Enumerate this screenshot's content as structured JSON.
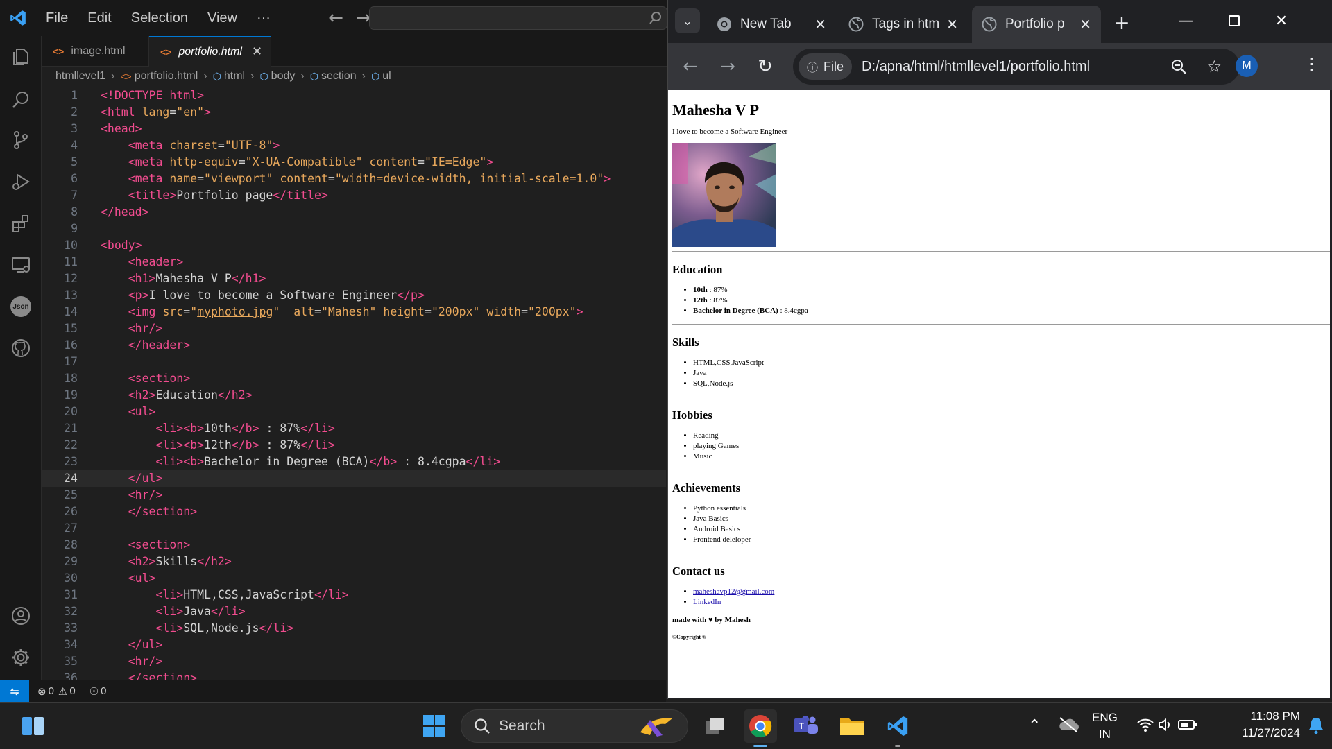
{
  "vscode": {
    "menu": [
      "File",
      "Edit",
      "Selection",
      "View",
      "···"
    ],
    "tabs": [
      {
        "label": "image.html",
        "active": false
      },
      {
        "label": "portfolio.html",
        "active": true
      }
    ],
    "breadcrumb": [
      "htmllevel1",
      "portfolio.html",
      "html",
      "body",
      "section",
      "ul"
    ],
    "current_line": 24,
    "status": {
      "errors": "0",
      "warnings": "0",
      "ports": "0"
    },
    "code_lines": [
      {
        "n": "1",
        "html": "<span class=\"t\">&lt;!DOCTYPE</span> <span class=\"t\">html</span><span class=\"t\">&gt;</span>"
      },
      {
        "n": "2",
        "html": "<span class=\"t\">&lt;html</span> <span class=\"a\">lang</span>=<span class=\"s\">\"en\"</span><span class=\"t\">&gt;</span>"
      },
      {
        "n": "3",
        "html": "<span class=\"t\">&lt;head&gt;</span>"
      },
      {
        "n": "4",
        "html": "    <span class=\"t\">&lt;meta</span> <span class=\"a\">charset</span>=<span class=\"s\">\"UTF-8\"</span><span class=\"t\">&gt;</span>"
      },
      {
        "n": "5",
        "html": "    <span class=\"t\">&lt;meta</span> <span class=\"a\">http-equiv</span>=<span class=\"s\">\"X-UA-Compatible\"</span> <span class=\"a\">content</span>=<span class=\"s\">\"IE=Edge\"</span><span class=\"t\">&gt;</span>"
      },
      {
        "n": "6",
        "html": "    <span class=\"t\">&lt;meta</span> <span class=\"a\">name</span>=<span class=\"s\">\"viewport\"</span> <span class=\"a\">content</span>=<span class=\"s\">\"width=device-width, initial-scale=1.0\"</span><span class=\"t\">&gt;</span>"
      },
      {
        "n": "7",
        "html": "    <span class=\"t\">&lt;title&gt;</span>Portfolio page<span class=\"t\">&lt;/title&gt;</span>"
      },
      {
        "n": "8",
        "html": "<span class=\"t\">&lt;/head&gt;</span>"
      },
      {
        "n": "9",
        "html": ""
      },
      {
        "n": "10",
        "html": "<span class=\"t\">&lt;body&gt;</span>"
      },
      {
        "n": "11",
        "html": "    <span class=\"t\">&lt;header&gt;</span>"
      },
      {
        "n": "12",
        "html": "    <span class=\"t\">&lt;h1&gt;</span>Mahesha V P<span class=\"t\">&lt;/h1&gt;</span>"
      },
      {
        "n": "13",
        "html": "    <span class=\"t\">&lt;p&gt;</span>I love to become a Software Engineer<span class=\"t\">&lt;/p&gt;</span>"
      },
      {
        "n": "14",
        "html": "    <span class=\"t\">&lt;img</span> <span class=\"a\">src</span>=<span class=\"s\">\"</span><span class=\"u\">myphoto.jpg</span><span class=\"s\">\"</span>  <span class=\"a\">alt</span>=<span class=\"s\">\"Mahesh\"</span> <span class=\"a\">height</span>=<span class=\"s\">\"200px\"</span> <span class=\"a\">width</span>=<span class=\"s\">\"200px\"</span><span class=\"t\">&gt;</span>"
      },
      {
        "n": "15",
        "html": "    <span class=\"t\">&lt;hr/&gt;</span>"
      },
      {
        "n": "16",
        "html": "    <span class=\"t\">&lt;/header&gt;</span>"
      },
      {
        "n": "17",
        "html": ""
      },
      {
        "n": "18",
        "html": "    <span class=\"t\">&lt;section&gt;</span>"
      },
      {
        "n": "19",
        "html": "    <span class=\"t\">&lt;h2&gt;</span>Education<span class=\"t\">&lt;/h2&gt;</span>"
      },
      {
        "n": "20",
        "html": "    <span class=\"t\">&lt;ul&gt;</span>"
      },
      {
        "n": "21",
        "html": "        <span class=\"t\">&lt;li&gt;&lt;b&gt;</span>10th<span class=\"t\">&lt;/b&gt;</span> : 87%<span class=\"t\">&lt;/li&gt;</span>"
      },
      {
        "n": "22",
        "html": "        <span class=\"t\">&lt;li&gt;&lt;b&gt;</span>12th<span class=\"t\">&lt;/b&gt;</span> : 87%<span class=\"t\">&lt;/li&gt;</span>"
      },
      {
        "n": "23",
        "html": "        <span class=\"t\">&lt;li&gt;&lt;b&gt;</span>Bachelor in Degree (BCA)<span class=\"t\">&lt;/b&gt;</span> : 8.4cgpa<span class=\"t\">&lt;/li&gt;</span>"
      },
      {
        "n": "24",
        "html": "    <span class=\"t\">&lt;/ul&gt;</span>"
      },
      {
        "n": "25",
        "html": "    <span class=\"t\">&lt;hr/&gt;</span>"
      },
      {
        "n": "26",
        "html": "    <span class=\"t\">&lt;/section&gt;</span>"
      },
      {
        "n": "27",
        "html": ""
      },
      {
        "n": "28",
        "html": "    <span class=\"t\">&lt;section&gt;</span>"
      },
      {
        "n": "29",
        "html": "    <span class=\"t\">&lt;h2&gt;</span>Skills<span class=\"t\">&lt;/h2&gt;</span>"
      },
      {
        "n": "30",
        "html": "    <span class=\"t\">&lt;ul&gt;</span>"
      },
      {
        "n": "31",
        "html": "        <span class=\"t\">&lt;li&gt;</span>HTML,CSS,JavaScript<span class=\"t\">&lt;/li&gt;</span>"
      },
      {
        "n": "32",
        "html": "        <span class=\"t\">&lt;li&gt;</span>Java<span class=\"t\">&lt;/li&gt;</span>"
      },
      {
        "n": "33",
        "html": "        <span class=\"t\">&lt;li&gt;</span>SQL,Node.js<span class=\"t\">&lt;/li&gt;</span>"
      },
      {
        "n": "34",
        "html": "    <span class=\"t\">&lt;/ul&gt;</span>"
      },
      {
        "n": "35",
        "html": "    <span class=\"t\">&lt;hr/&gt;</span>"
      },
      {
        "n": "36",
        "html": "    <span class=\"t\">&lt;/section&gt;</span>"
      }
    ]
  },
  "chrome": {
    "tabs": [
      {
        "title": "New Tab",
        "active": false
      },
      {
        "title": "Tags in htm",
        "active": false
      },
      {
        "title": "Portfolio p",
        "active": true
      }
    ],
    "chip_label": "File",
    "url": "D:/apna/html/htmllevel1/portfolio.html",
    "profile_initial": "M"
  },
  "page": {
    "name": "Mahesha V P",
    "intro": "I love to become a Software Engineer",
    "education_title": "Education",
    "education": [
      {
        "b": "10th",
        "rest": " : 87%"
      },
      {
        "b": "12th",
        "rest": " : 87%"
      },
      {
        "b": "Bachelor in Degree (BCA)",
        "rest": " : 8.4cgpa"
      }
    ],
    "skills_title": "Skills",
    "skills": [
      "HTML,CSS,JavaScript",
      "Java",
      "SQL,Node.js"
    ],
    "hobbies_title": "Hobbies",
    "hobbies": [
      "Reading",
      "playing Games",
      "Music"
    ],
    "achievements_title": "Achievements",
    "achievements": [
      "Python essentials",
      "Java Basics",
      "Android Basics",
      "Frontend deleloper"
    ],
    "contact_title": "Contact us",
    "contacts": [
      "maheshavp12@gmail.com",
      "LinkedIn"
    ],
    "made_with": "made with ♥ by Mahesh",
    "copyright": "©Copyright ®"
  },
  "taskbar": {
    "search_label": "Search",
    "lang_top": "ENG",
    "lang_bottom": "IN",
    "time": "11:08 PM",
    "date": "11/27/2024"
  }
}
